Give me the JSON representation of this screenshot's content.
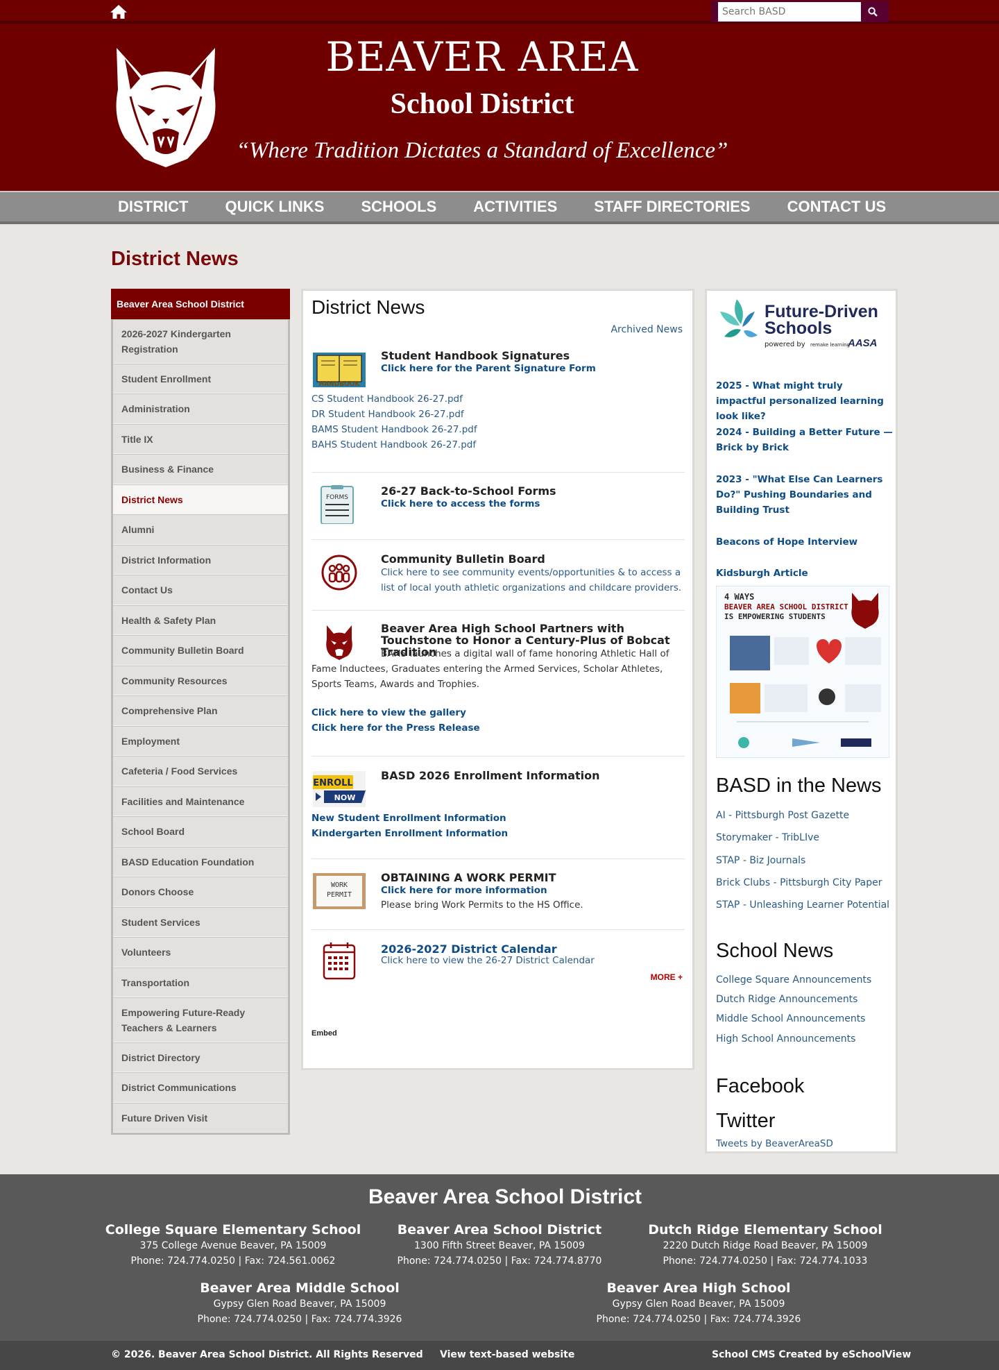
{
  "topbar": {
    "search_placeholder": "Search BASD"
  },
  "header": {
    "title_line1": "BEAVER AREA",
    "title_line2": "School District",
    "tagline": "“Where Tradition Dictates a Standard of Excellence”"
  },
  "nav": [
    "DISTRICT",
    "QUICK LINKS",
    "SCHOOLS",
    "ACTIVITIES",
    "STAFF DIRECTORIES",
    "CONTACT US"
  ],
  "page_title": "District News",
  "sidebar": {
    "heading": "Beaver Area School District",
    "items": [
      "2026-2027 Kindergarten Registration",
      "Student Enrollment",
      "Administration",
      "Title IX",
      "Business & Finance",
      "District News",
      "Alumni",
      "District Information",
      "Contact Us",
      "Health & Safety Plan",
      "Community Bulletin Board",
      "Community Resources",
      "Comprehensive Plan",
      "Employment",
      "Cafeteria / Food Services",
      "Facilities and Maintenance",
      "School Board",
      "BASD Education Foundation",
      "Donors Choose",
      "Student Services",
      "Volunteers",
      "Transportation",
      "Empowering Future-Ready Teachers & Learners",
      "District Directory",
      "District Communications",
      "Future Driven Visit"
    ],
    "active": "District News"
  },
  "main": {
    "title": "District News",
    "archived": "Archived News",
    "news": {
      "handbook": {
        "icon_text": "HANDBOOK",
        "title": "Student Handbook Signatures",
        "link": "Click here for the Parent Signature Form",
        "files": [
          "CS Student Handbook 26-27.pdf",
          "DR Student Handbook 26-27.pdf",
          "BAMS Student Handbook 26-27.pdf",
          "BAHS Student Handbook 26-27.pdf"
        ]
      },
      "forms": {
        "icon_text": "FORMS",
        "title": "26-27 Back-to-School Forms",
        "link": "Click here to access the forms"
      },
      "bulletin": {
        "title": "Community Bulletin Board",
        "text": "Click here to see community events/opportunities & to access a list of local youth athletic organizations and childcare providers."
      },
      "touchstone": {
        "title": "Beaver Area High School Partners with Touchstone to Honor a Century-Plus of Bobcat Tradition",
        "text": "BAHS launches a digital wall of fame honoring Athletic Hall of Fame Inductees, Graduates entering the Armed Services, Scholar Athletes, Sports Teams, Awards and Trophies.",
        "links": [
          "Click here to view the gallery",
          "Click here for the Press Release"
        ]
      },
      "enrollment": {
        "icon_text1": "ENROLL",
        "icon_text2": "NOW",
        "title": "BASD 2026 Enrollment Information",
        "links": [
          "New Student Enrollment Information",
          "Kindergarten Enrollment Information"
        ]
      },
      "permit": {
        "icon_text1": "WORK",
        "icon_text2": "PERMIT",
        "title": "OBTAINING A WORK PERMIT",
        "link": "Click here for more information",
        "text": "Please bring Work Permits to the HS Office."
      },
      "calendar": {
        "title": "2026-2027 District Calendar",
        "text": "Click here to view the 26-27 District Calendar"
      }
    },
    "more": "MORE +",
    "embed": "Embed"
  },
  "right": {
    "fds": {
      "line1": "Future-Driven",
      "line2": "Schools",
      "powered": "powered by",
      "remake": "remake learning",
      "aasa": "AASA"
    },
    "fds_links": [
      "2025 - What might truly impactful personalized learning look like?",
      "2024 - Building a Better Future — Brick by Brick",
      "2023 - \"What Else Can Learners Do?\" Pushing Boundaries and Building Trust",
      "Beacons of Hope Interview",
      "Kidsburgh Article"
    ],
    "poster": {
      "title_line1": "4 WAYS",
      "title_line2": "BEAVER AREA SCHOOL DISTRICT",
      "title_line3": "IS EMPOWERING STUDENTS"
    },
    "in_news_heading": "BASD in the News",
    "in_news": [
      "AI - Pittsburgh Post Gazette",
      "Storymaker - TribLIve",
      "STAP - Biz Journals",
      "Brick Clubs - Pittsburgh City Paper",
      "STAP - Unleashing Learner Potential"
    ],
    "school_news_heading": "School News",
    "school_news": [
      "College Square Announcements",
      "Dutch Ridge Announcements",
      "Middle School Announcements",
      "High School Announcements"
    ],
    "facebook": "Facebook",
    "twitter": "Twitter",
    "tweets": "Tweets by BeaverAreaSD"
  },
  "footer": {
    "title": "Beaver Area School District",
    "schools": [
      {
        "name": "College Square Elementary School",
        "address": "375 College Avenue Beaver, PA 15009",
        "phone": "Phone: 724.774.0250 | Fax: 724.561.0062"
      },
      {
        "name": "Beaver Area School District",
        "address": "1300 Fifth Street Beaver, PA 15009",
        "phone": "Phone: 724.774.0250 | Fax: 724.774.8770"
      },
      {
        "name": "Dutch Ridge Elementary School",
        "address": "2220 Dutch Ridge Road Beaver, PA 15009",
        "phone": "Phone: 724.774.0250 | Fax: 724.774.1033"
      },
      {
        "name": "Beaver Area Middle School",
        "address": "Gypsy Glen Road Beaver, PA 15009",
        "phone": "Phone: 724.774.0250 | Fax: 724.774.3926"
      },
      {
        "name": "Beaver Area High School",
        "address": "Gypsy Glen Road Beaver, PA 15009",
        "phone": "Phone: 724.774.0250 | Fax: 724.774.3926"
      }
    ],
    "copyright": "© 2026. Beaver Area School District. All Rights Reserved",
    "text_site": "View text-based website",
    "cms": "School CMS Created by eSchoolView"
  }
}
